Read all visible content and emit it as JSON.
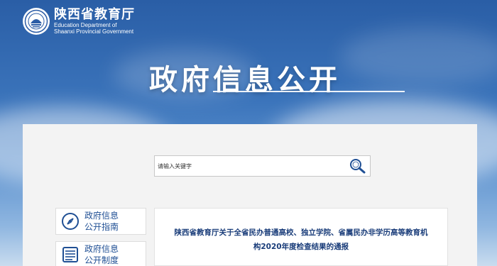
{
  "header": {
    "org_name_cn": "陕西省教育厅",
    "org_name_en_line1": "Education Department of",
    "org_name_en_line2": "Shaanxi Provincial Government",
    "logo_icon": "education-department-seal-icon"
  },
  "page_title": "政府信息公开",
  "search": {
    "placeholder": "请输入关键字",
    "value": "",
    "button_icon": "search-icon"
  },
  "sidebar": {
    "items": [
      {
        "line1": "政府信息",
        "line2": "公开指南",
        "icon": "compass-icon"
      },
      {
        "line1": "政府信息",
        "line2": "公开制度",
        "icon": "document-list-icon"
      }
    ]
  },
  "article": {
    "title_line1": "陕西省教育厅关于全省民办普通高校、独立学院、省属民办非学历高等教育机",
    "title_line2": "构2020年度检查结果的通报"
  },
  "colors": {
    "sky_top": "#2a5ea6",
    "sky_bottom": "#c9dcef",
    "panel_bg": "#f3f3f3",
    "link_blue": "#1f4f94"
  }
}
